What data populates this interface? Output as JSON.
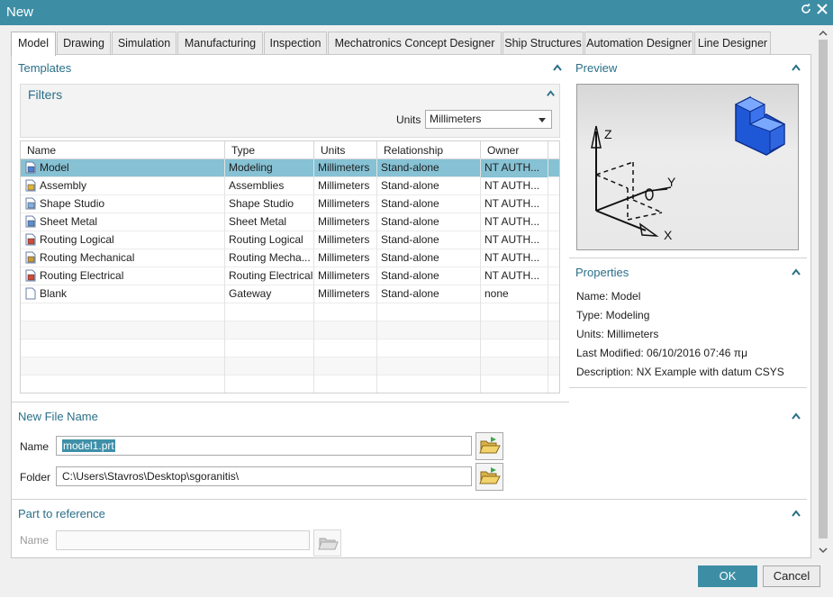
{
  "window": {
    "title": "New",
    "accent": "#3d8ea4"
  },
  "tabs": [
    {
      "label": "Model",
      "active": true
    },
    {
      "label": "Drawing"
    },
    {
      "label": "Simulation"
    },
    {
      "label": "Manufacturing"
    },
    {
      "label": "Inspection"
    },
    {
      "label": "Mechatronics Concept Designer"
    },
    {
      "label": "Ship Structures"
    },
    {
      "label": "Automation Designer"
    },
    {
      "label": "Line Designer"
    }
  ],
  "templates": {
    "title": "Templates",
    "filters": {
      "title": "Filters",
      "units_label": "Units",
      "units_value": "Millimeters"
    },
    "columns": [
      "Name",
      "Type",
      "Units",
      "Relationship",
      "Owner"
    ],
    "rows": [
      {
        "name": "Model",
        "type": "Modeling",
        "units": "Millimeters",
        "relationship": "Stand-alone",
        "owner": "NT AUTH...",
        "icon": "model-icon",
        "selected": true
      },
      {
        "name": "Assembly",
        "type": "Assemblies",
        "units": "Millimeters",
        "relationship": "Stand-alone",
        "owner": "NT AUTH...",
        "icon": "assembly-icon"
      },
      {
        "name": "Shape Studio",
        "type": "Shape Studio",
        "units": "Millimeters",
        "relationship": "Stand-alone",
        "owner": "NT AUTH...",
        "icon": "shape-studio-icon"
      },
      {
        "name": "Sheet Metal",
        "type": "Sheet Metal",
        "units": "Millimeters",
        "relationship": "Stand-alone",
        "owner": "NT AUTH...",
        "icon": "sheet-metal-icon"
      },
      {
        "name": "Routing Logical",
        "type": "Routing Logical",
        "units": "Millimeters",
        "relationship": "Stand-alone",
        "owner": "NT AUTH...",
        "icon": "routing-logical-icon"
      },
      {
        "name": "Routing Mechanical",
        "type": "Routing Mecha...",
        "units": "Millimeters",
        "relationship": "Stand-alone",
        "owner": "NT AUTH...",
        "icon": "routing-mechanical-icon"
      },
      {
        "name": "Routing Electrical",
        "type": "Routing Electrical",
        "units": "Millimeters",
        "relationship": "Stand-alone",
        "owner": "NT AUTH...",
        "icon": "routing-electrical-icon"
      },
      {
        "name": "Blank",
        "type": "Gateway",
        "units": "Millimeters",
        "relationship": "Stand-alone",
        "owner": "none",
        "icon": "blank-page-icon"
      }
    ]
  },
  "preview": {
    "title": "Preview",
    "axis_x": "X",
    "axis_y": "Y",
    "axis_z": "Z"
  },
  "properties": {
    "title": "Properties",
    "name": "Name: Model",
    "type": "Type: Modeling",
    "units": "Units: Millimeters",
    "last_modified": "Last Modified: 06/10/2016 07:46 πμ",
    "description": "Description: NX Example with datum CSYS"
  },
  "new_file": {
    "title": "New File Name",
    "name_label": "Name",
    "name_value": "model1.prt",
    "folder_label": "Folder",
    "folder_value": "C:\\Users\\Stavros\\Desktop\\sgoranitis\\"
  },
  "part_reference": {
    "title": "Part to reference",
    "name_label": "Name",
    "name_value": ""
  },
  "buttons": {
    "ok": "OK",
    "cancel": "Cancel"
  }
}
